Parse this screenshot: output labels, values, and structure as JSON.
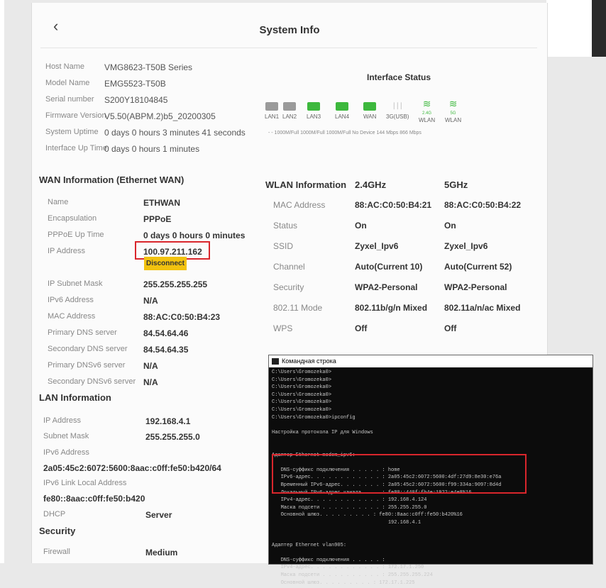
{
  "header": {
    "title": "System Info"
  },
  "system": [
    {
      "label": "Host Name",
      "value": "VMG8623-T50B Series"
    },
    {
      "label": "Model Name",
      "value": "EMG5523-T50B"
    },
    {
      "label": "Serial number",
      "value": "S200Y18104845"
    },
    {
      "label": "Firmware Version",
      "value": "V5.50(ABPM.2)b5_20200305"
    },
    {
      "label": "System Uptime",
      "value": "0 days 0 hours 3 minutes 41 seconds"
    },
    {
      "label": "Interface Up Time",
      "value": "0 days 0 hours 1 minutes"
    }
  ],
  "interface_status": {
    "title": "Interface Status",
    "ports": [
      {
        "label": "LAN1",
        "color": "#9a9a9a"
      },
      {
        "label": "LAN2",
        "color": "#9a9a9a"
      },
      {
        "label": "LAN3",
        "color": "#3db83d"
      },
      {
        "label": "LAN4",
        "color": "#3db83d"
      },
      {
        "label": "WAN",
        "color": "#3db83d"
      },
      {
        "label": "3G(USB)",
        "color": "#bbbbbb"
      },
      {
        "label": "WLAN",
        "band": "2.4G",
        "color": "#3db83d"
      },
      {
        "label": "WLAN",
        "band": "5G",
        "color": "#3db83d"
      }
    ],
    "speeds": "-     -    1000M/Full 1000M/Full 1000M/Full No Device 144 Mbps 866 Mbps"
  },
  "wan": {
    "title": "WAN Information (Ethernet WAN)",
    "rows": [
      {
        "label": "Name",
        "value": "ETHWAN"
      },
      {
        "label": "Encapsulation",
        "value": "PPPoE"
      },
      {
        "label": "PPPoE Up Time",
        "value": "0 days 0 hours 0 minutes"
      },
      {
        "label": "IP Address",
        "value": "100.97.211.162"
      },
      {
        "label": "IP Subnet Mask",
        "value": "255.255.255.255"
      },
      {
        "label": "IPv6 Address",
        "value": "N/A"
      },
      {
        "label": "MAC Address",
        "value": "88:AC:C0:50:B4:23"
      },
      {
        "label": "Primary DNS server",
        "value": "84.54.64.46"
      },
      {
        "label": "Secondary DNS server",
        "value": "84.54.64.35"
      },
      {
        "label": "Primary DNSv6 server",
        "value": "N/A"
      },
      {
        "label": "Secondary DNSv6 server",
        "value": "N/A"
      }
    ],
    "disconnect_label": "Disconnect"
  },
  "wlan": {
    "title": "WLAN Information",
    "col24": "2.4GHz",
    "col5": "5GHz",
    "rows": [
      {
        "label": "MAC Address",
        "v24": "88:AC:C0:50:B4:21",
        "v5": "88:AC:C0:50:B4:22"
      },
      {
        "label": "Status",
        "v24": "On",
        "v5": "On"
      },
      {
        "label": "SSID",
        "v24": "Zyxel_Ipv6",
        "v5": "Zyxel_Ipv6"
      },
      {
        "label": "Channel",
        "v24": "Auto(Current 10)",
        "v5": "Auto(Current 52)"
      },
      {
        "label": "Security",
        "v24": "WPA2-Personal",
        "v5": "WPA2-Personal"
      },
      {
        "label": "802.11 Mode",
        "v24": "802.11b/g/n Mixed",
        "v5": "802.11a/n/ac Mixed"
      },
      {
        "label": "WPS",
        "v24": "Off",
        "v5": "Off"
      }
    ]
  },
  "lan": {
    "title": "LAN Information",
    "ip_label": "IP Address",
    "ip": "192.168.4.1",
    "mask_label": "Subnet Mask",
    "mask": "255.255.255.0",
    "ipv6_label": "IPv6 Address",
    "ipv6": "2a05:45c2:6072:5600:8aac:c0ff:fe50:b420/64",
    "ll_label": "IPv6 Link Local Address",
    "ll": "fe80::8aac:c0ff:fe50:b420",
    "dhcp_label": "DHCP",
    "dhcp": "Server"
  },
  "security": {
    "title": "Security",
    "fw_label": "Firewall",
    "fw": "Medium"
  },
  "cmd": {
    "title": "Командная строка",
    "lines": [
      "C:\\Users\\Gromozeka0>",
      "C:\\Users\\Gromozeka0>",
      "C:\\Users\\Gromozeka0>",
      "C:\\Users\\Gromozeka0>",
      "C:\\Users\\Gromozeka0>",
      "C:\\Users\\Gromozeka0>",
      "C:\\Users\\Gromozeka0>ipconfig",
      "",
      "Настройка протокола IP для Windows",
      "",
      "",
      "Адаптер Ethernet modem_ipv6:",
      "",
      "   DNS-суффикс подключения . . . . . : home",
      "   IPv6-адрес. . . . . . . . . . . . : 2a05:45c2:6072:5600:4df:27d9:8e30:e76a",
      "   Временный IPv6-адрес. . . . . . . : 2a05:45c2:6072:5600:f99:334a:9097:8d4d",
      "   Локальный IPv6-адрес канала . . . : fe80::440f:fb4e:1922:e4e8%16",
      "   IPv4-адрес. . . . . . . . . . . . : 192.168.4.124",
      "   Маска подсети . . . . . . . . . . : 255.255.255.0",
      "   Основной шлюз. . . . . . . . . : fe80::8aac:c0ff:fe50:b420%16",
      "                                       192.168.4.1",
      "",
      "",
      "Адаптер Ethernet vlan905:",
      "",
      "   DNS-суффикс подключения . . . . . :",
      "   IPv4-адрес. . . . . . . . . . . . : 172.17.1.250",
      "   Маска подсети . . . . . . . . . . : 255.255.255.224",
      "   Основной шлюз. . . . . . . . . : 172.17.1.225"
    ]
  }
}
